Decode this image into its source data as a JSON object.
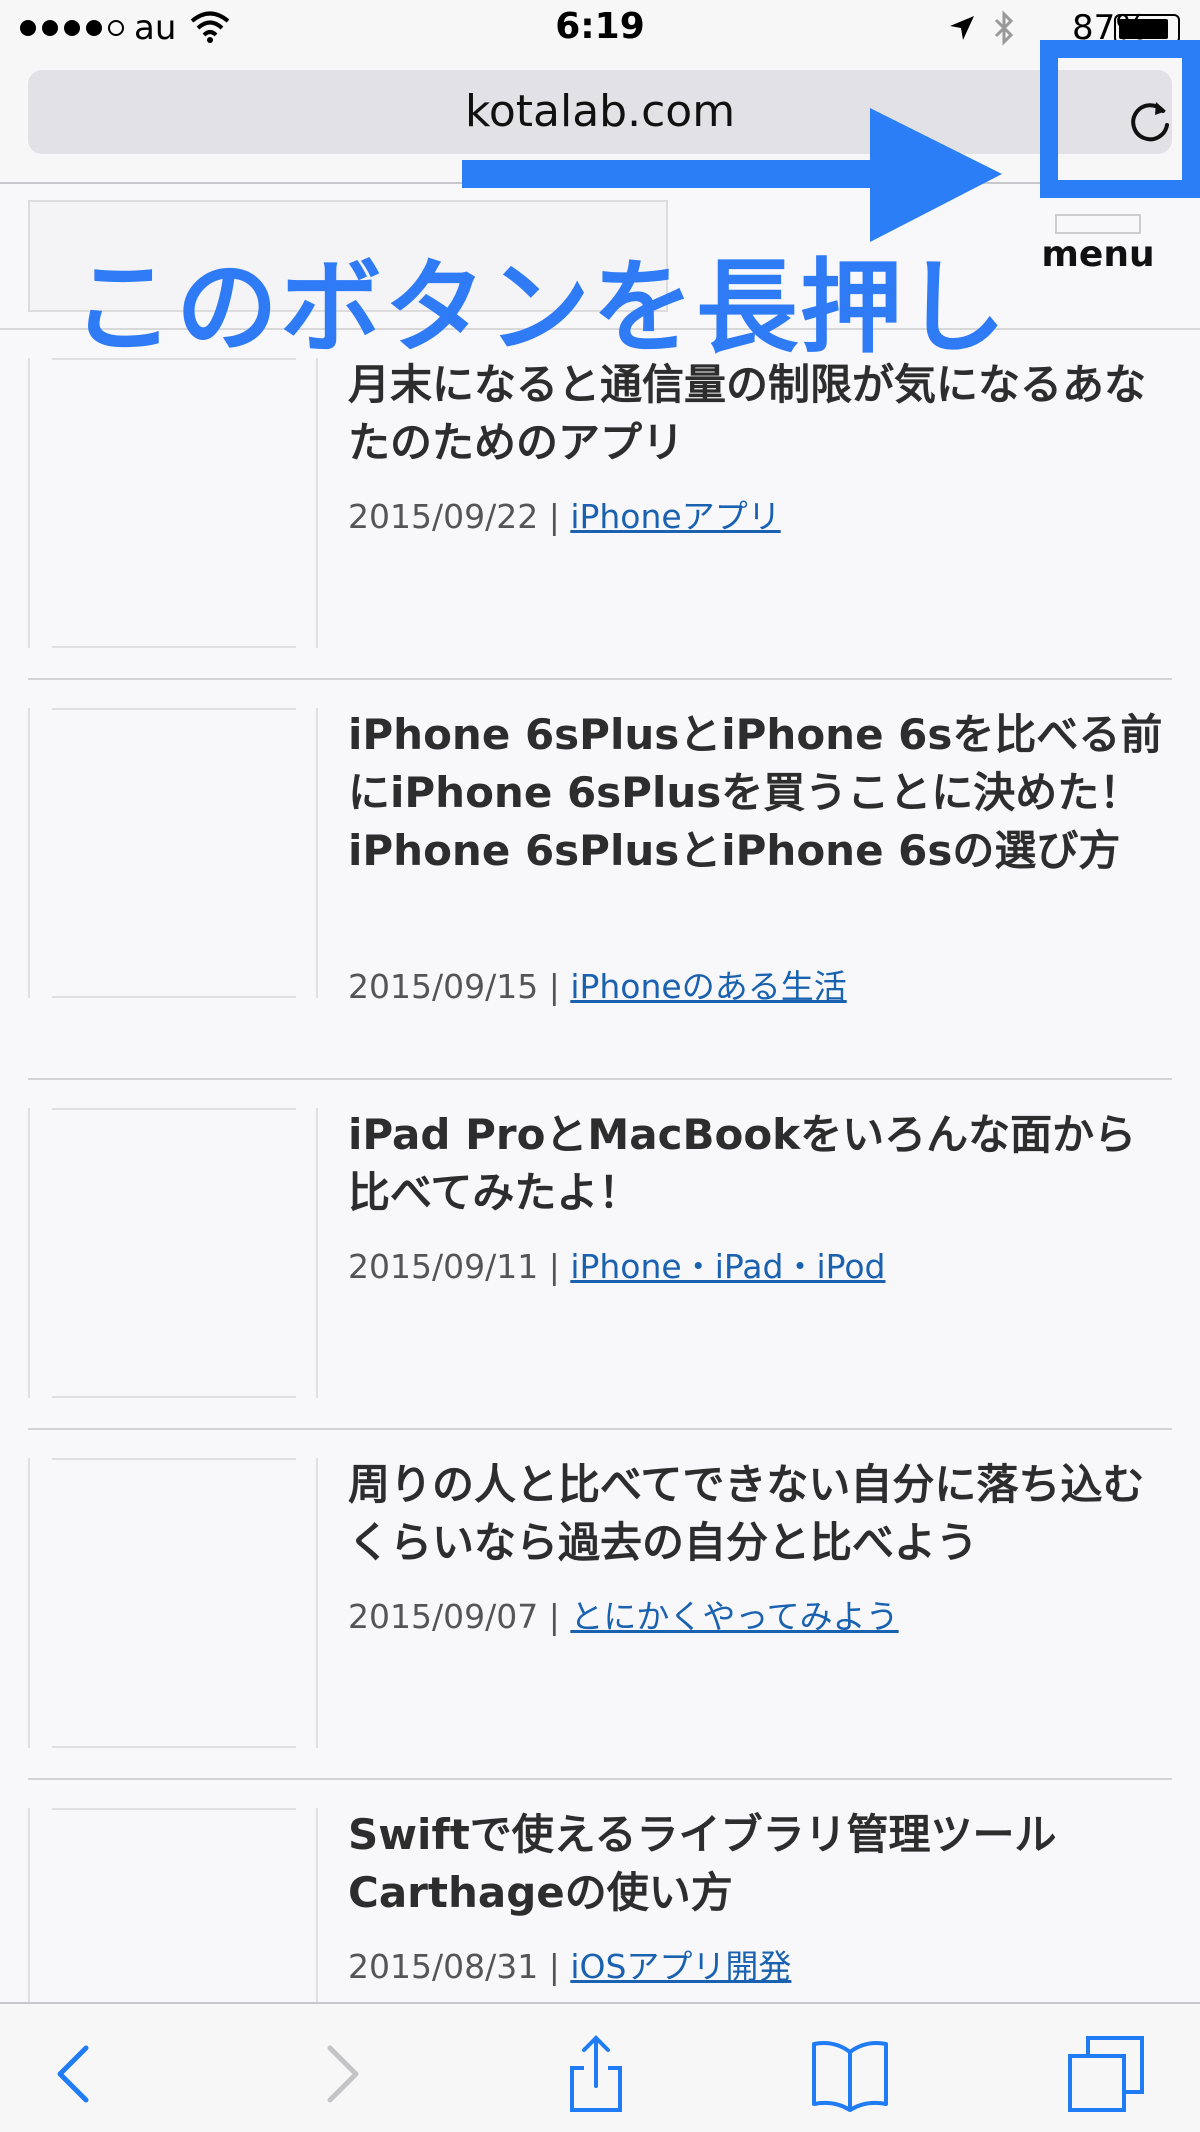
{
  "status_bar": {
    "carrier": "au",
    "time": "6:19",
    "battery_percent": "87%",
    "battery_level": 0.87,
    "signal_dots": 5,
    "signal_filled": 4
  },
  "url_bar": {
    "domain": "kotalab.com"
  },
  "site_header": {
    "menu_label": "menu"
  },
  "annotation": {
    "text": "このボタンを長押し",
    "color": "#2c7ef7"
  },
  "articles": [
    {
      "title": "月末になると通信量の制限が気になるあなたのためのアプリ",
      "date": "2015/09/22",
      "separator": " | ",
      "category": "iPhoneアプリ"
    },
    {
      "title": "iPhone 6sPlusとiPhone 6sを比べる前にiPhone 6sPlusを買うことに決めた！iPhone 6sPlusとiPhone 6sの選び方",
      "date": "2015/09/15",
      "separator": " | ",
      "category": "iPhoneのある生活"
    },
    {
      "title": "iPad ProとMacBookをいろんな面から比べてみたよ！",
      "date": "2015/09/11",
      "separator": " | ",
      "category": "iPhone・iPad・iPod"
    },
    {
      "title": "周りの人と比べてできない自分に落ち込むくらいなら過去の自分と比べよう",
      "date": "2015/09/07",
      "separator": " | ",
      "category": "とにかくやってみよう"
    },
    {
      "title": "Swiftで使えるライブラリ管理ツールCarthageの使い方",
      "date": "2015/08/31",
      "separator": " | ",
      "category": "iOSアプリ開発"
    }
  ],
  "toolbar": {
    "icons": [
      "back-icon",
      "forward-icon",
      "share-icon",
      "bookmarks-icon",
      "tabs-icon"
    ]
  }
}
